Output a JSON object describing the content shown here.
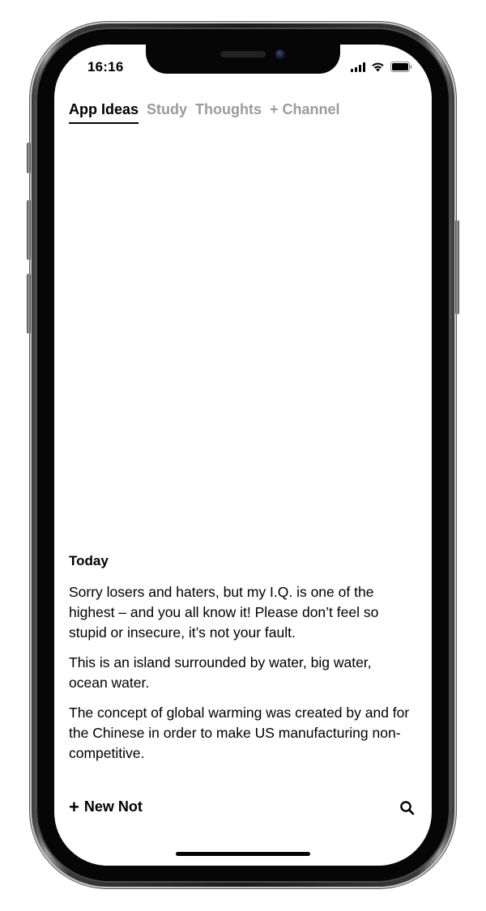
{
  "status_bar": {
    "time": "16:16",
    "signal_icon": "cellular-signal-icon",
    "wifi_icon": "wifi-icon",
    "battery_icon": "battery-icon"
  },
  "tabs": [
    {
      "label": "App Ideas",
      "active": true
    },
    {
      "label": "Study",
      "active": false
    },
    {
      "label": "Thoughts",
      "active": false
    },
    {
      "label": "+ Channel",
      "active": false
    }
  ],
  "notes": {
    "section_title": "Today",
    "items": [
      "Sorry losers and haters, but my I.Q. is one of the highest – and you all know it! Please don’t feel so stupid or insecure, it’s not your fault.",
      "This is an island surrounded by water, big water, ocean water.",
      "The concept of global warming was created by and  for the Chinese in order to make US manufacturing non-competitive."
    ]
  },
  "bottom_bar": {
    "new_note_icon": "plus-icon",
    "new_note_label": "New Not",
    "search_icon": "search-icon"
  },
  "colors": {
    "active_tab": "#000000",
    "inactive_tab": "#9b9b9b",
    "background": "#ffffff"
  }
}
